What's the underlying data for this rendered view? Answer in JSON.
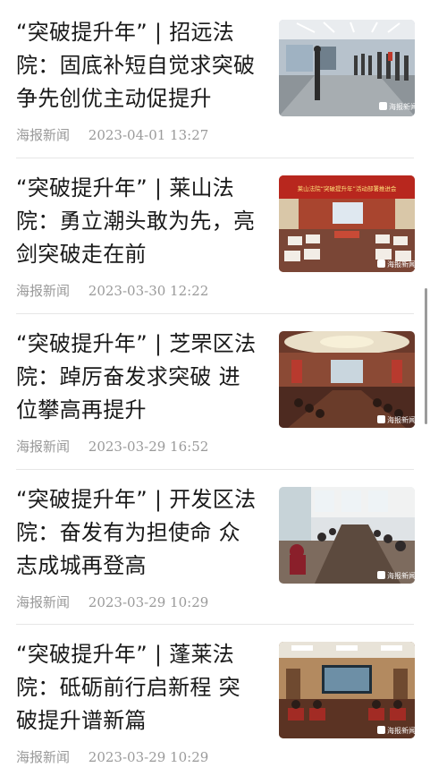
{
  "feed": {
    "items": [
      {
        "title": "“突破提升年” | 招远法院：固底补短自觉求突破 争先创优主动促提升",
        "source": "海报新闻",
        "time": "2023-04-01 13:27",
        "thumb_logo": "海报新闻"
      },
      {
        "title": "“突破提升年” | 莱山法院：勇立潮头敢为先，亮剑突破走在前",
        "source": "海报新闻",
        "time": "2023-03-30 12:22",
        "thumb_logo": "海报新闻",
        "thumb_banner": "莱山法院“突破提升年”活动部署推进会"
      },
      {
        "title": "“突破提升年” | 芝罘区法院：踔厉奋发求突破 进位攀高再提升",
        "source": "海报新闻",
        "time": "2023-03-29 16:52",
        "thumb_logo": "海报新闻"
      },
      {
        "title": "“突破提升年” | 开发区法院：奋发有为担使命 众志成城再登高",
        "source": "海报新闻",
        "time": "2023-03-29 10:29",
        "thumb_logo": "海报新闻"
      },
      {
        "title": "“突破提升年” | 蓬莱法院：砥砺前行启新程 突破提升谱新篇",
        "source": "海报新闻",
        "time": "2023-03-29 10:29",
        "thumb_logo": "海报新闻"
      }
    ]
  }
}
